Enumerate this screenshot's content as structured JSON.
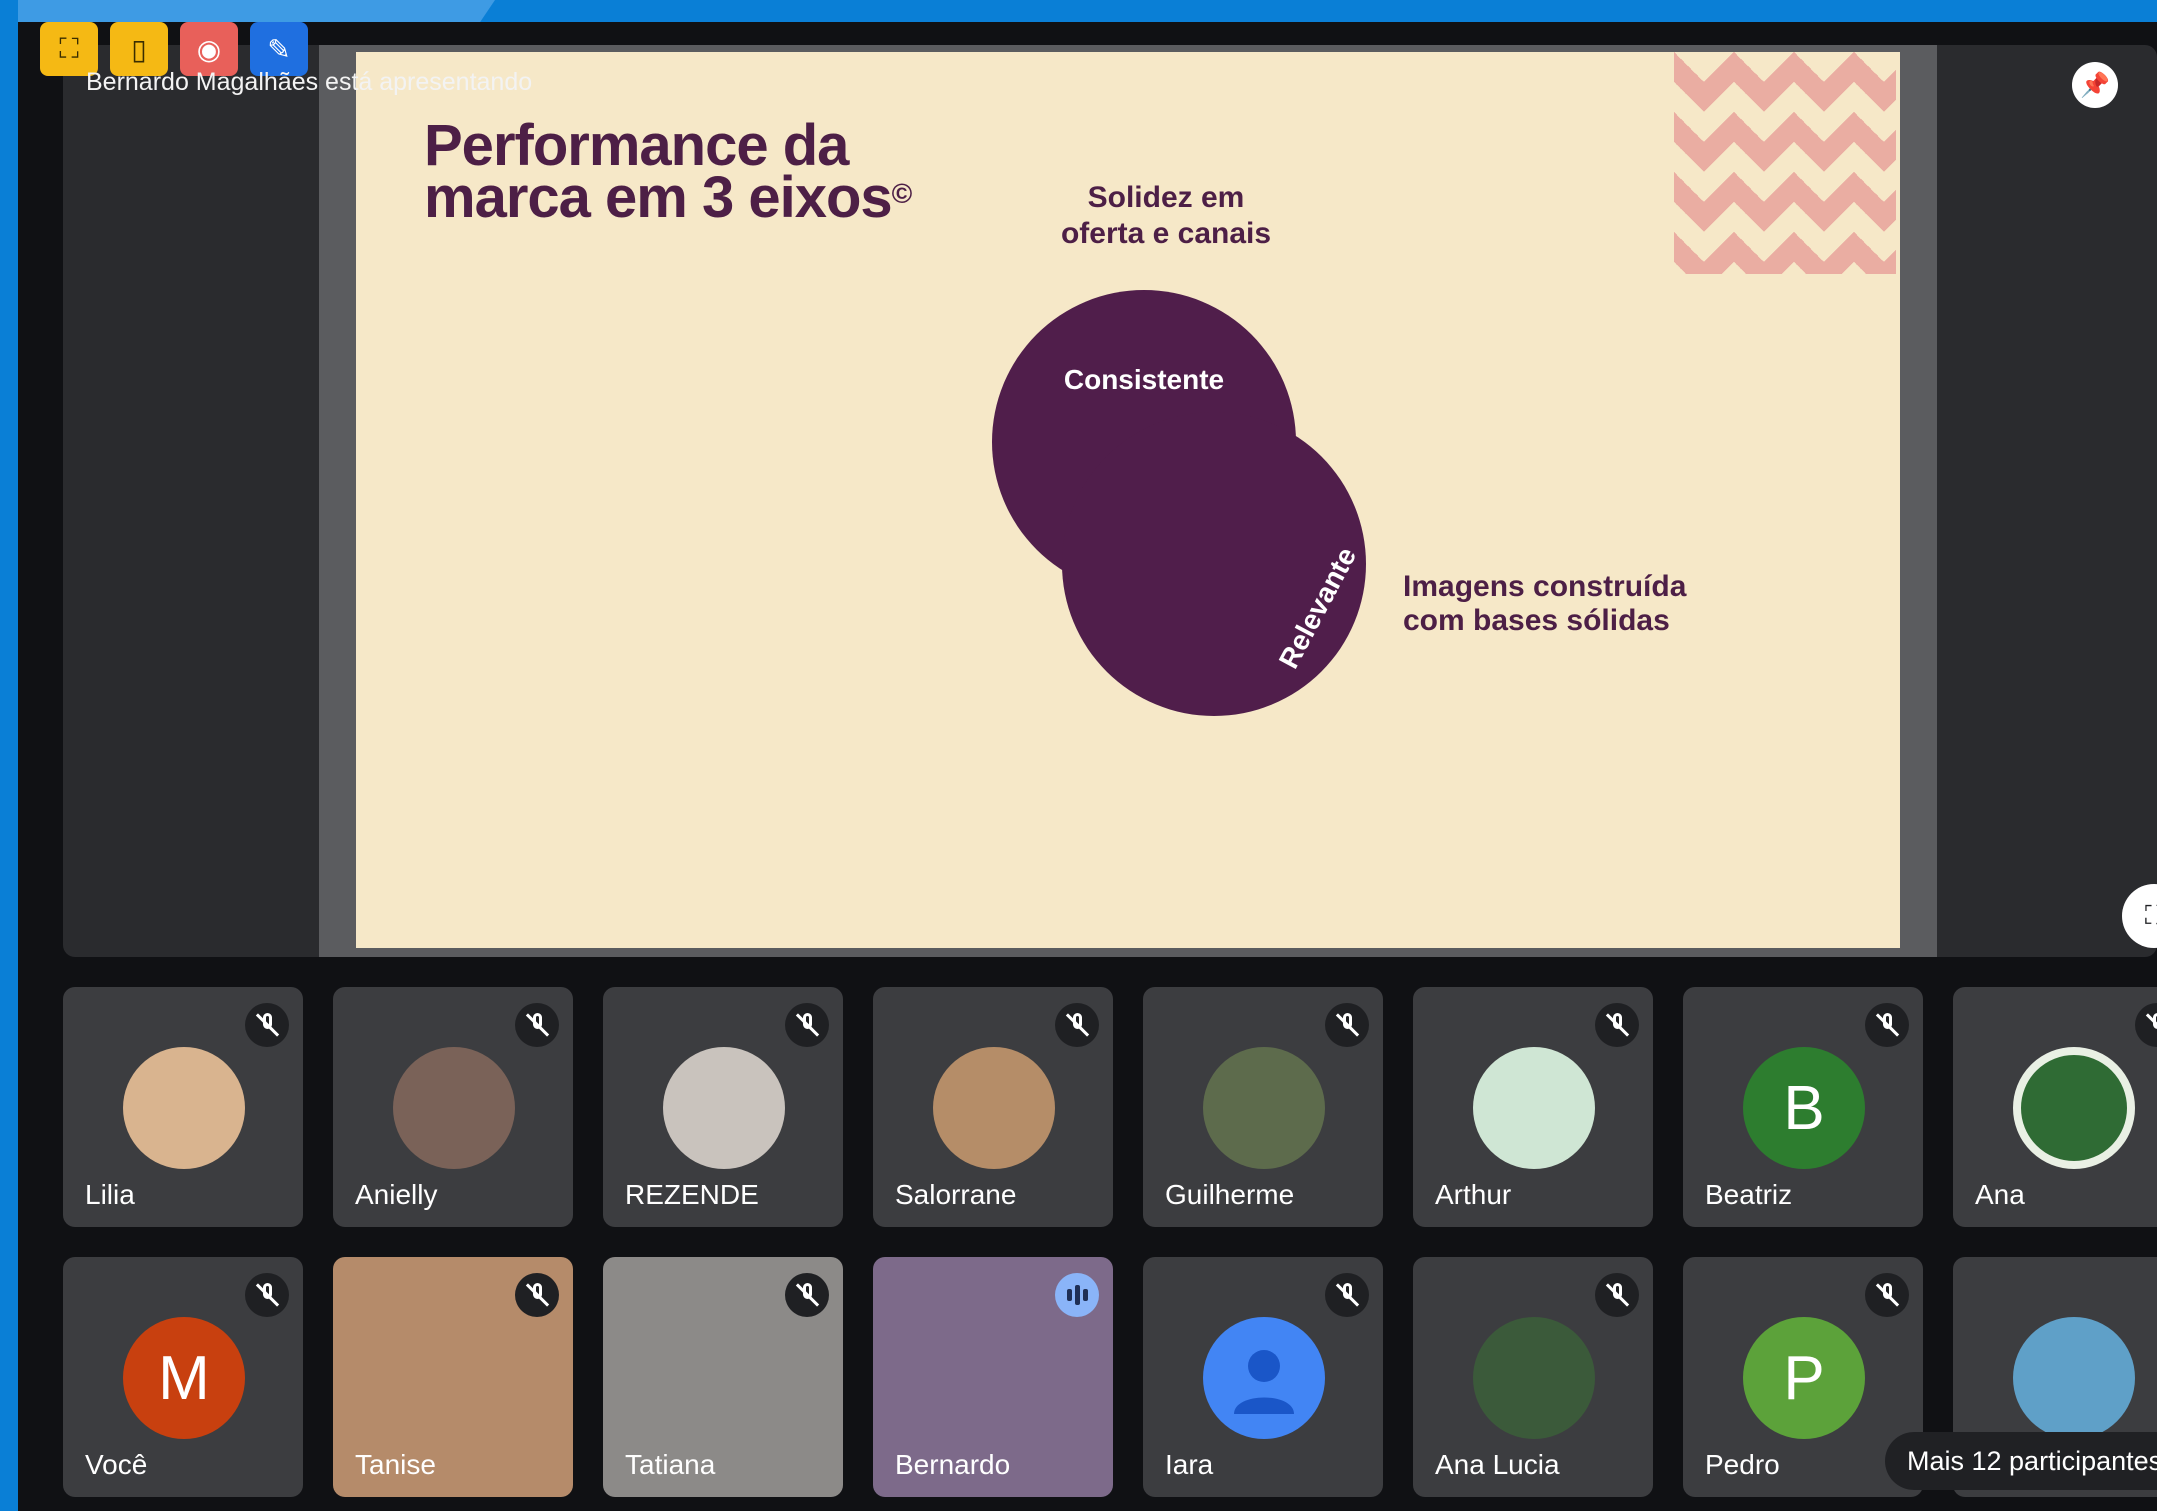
{
  "presenter_banner": "Bernardo Magalhães está apresentando",
  "toolbar": {
    "icons": [
      "slide-control-icon",
      "door-icon",
      "record-icon",
      "pen-icon"
    ]
  },
  "slide": {
    "title_line1": "Performance da",
    "title_line2": "marca em 3 eixos",
    "title_mark": "©",
    "top_label_line1": "Solidez em",
    "top_label_line2": "oferta e canais",
    "right_label_line1": "Imagens construída",
    "right_label_line2": "com bases sólidas",
    "circle_a": "Consistente",
    "circle_b": "Relevante",
    "colors": {
      "background": "#f6e8c8",
      "primary": "#501e4b",
      "accent": "#e9a39c"
    }
  },
  "participants_row1": [
    {
      "name": "Lilia",
      "avatar": "photo",
      "muted": true
    },
    {
      "name": "Anielly",
      "avatar": "photo",
      "muted": true
    },
    {
      "name": "REZENDE",
      "avatar": "photo",
      "muted": true
    },
    {
      "name": "Salorrane",
      "avatar": "photo",
      "muted": true
    },
    {
      "name": "Guilherme",
      "avatar": "photo",
      "muted": true
    },
    {
      "name": "Arthur",
      "avatar": "photo",
      "muted": true
    },
    {
      "name": "Beatriz",
      "initial": "B",
      "muted": true,
      "color": "#2d7d2f"
    },
    {
      "name": "Ana",
      "avatar": "logo",
      "muted": true
    }
  ],
  "participants_row2": [
    {
      "name": "Você",
      "initial": "M",
      "muted": true,
      "color": "#c8400f"
    },
    {
      "name": "Tanise",
      "avatar": "video",
      "muted": true
    },
    {
      "name": "Tatiana",
      "avatar": "video",
      "muted": true
    },
    {
      "name": "Bernardo",
      "avatar": "video",
      "speaking": true
    },
    {
      "name": "Iara",
      "avatar": "default",
      "muted": true,
      "color": "#4285f4"
    },
    {
      "name": "Ana Lucia",
      "avatar": "photo",
      "muted": true
    },
    {
      "name": "Pedro",
      "initial": "P",
      "muted": true,
      "color": "#5ca23a"
    },
    {
      "name": "",
      "avatar": "photo"
    }
  ],
  "more_participants": "Mais 12 participantes"
}
